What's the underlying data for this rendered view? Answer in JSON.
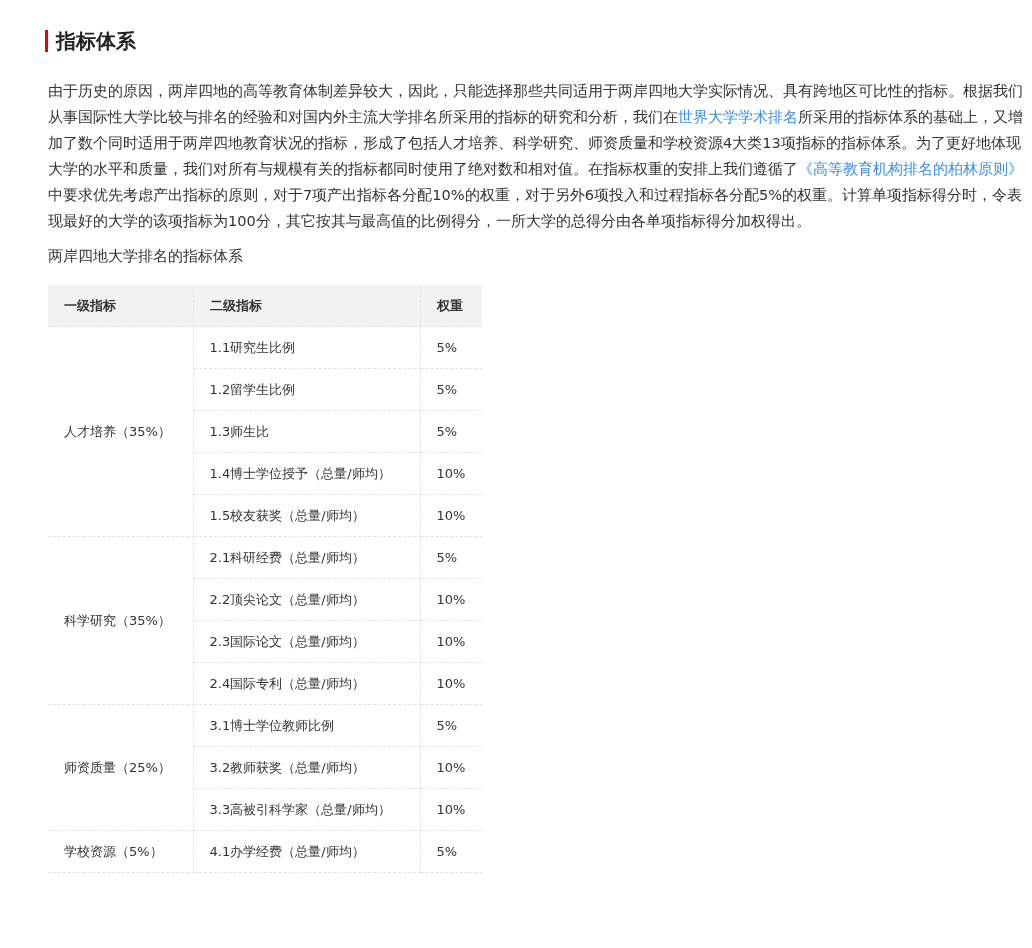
{
  "title": "指标体系",
  "intro": [
    {
      "kind": "text",
      "text": "由于历史的原因，两岸四地的高等教育体制差异较大，因此，只能选择那些共同适用于两岸四地大学实际情况、具有跨地区可比性的指标。根据我们从事国际性大学比较与排名的经验和对国内外主流大学排名所采用的指标的研究和分析，我们在"
    },
    {
      "kind": "link",
      "text": "世界大学学术排名"
    },
    {
      "kind": "text",
      "text": "所采用的指标体系的基础上，又增加了数个同时适用于两岸四地教育状况的指标，形成了包括人才培养、科学研究、师资质量和学校资源4大类13项指标的指标体系。为了更好地体现大学的水平和质量，我们对所有与规模有关的指标都同时使用了绝对数和相对值。在指标权重的安排上我们遵循了"
    },
    {
      "kind": "link",
      "text": "《高等教育机构排名的柏林原则》"
    },
    {
      "kind": "text",
      "text": "中要求优先考虑产出指标的原则，对于7项产出指标各分配10%的权重，对于另外6项投入和过程指标各分配5%的权重。计算单项指标得分时，令表现最好的大学的该项指标为100分，其它按其与最高值的比例得分，一所大学的总得分由各单项指标得分加权得出。"
    }
  ],
  "caption": "两岸四地大学排名的指标体系",
  "table": {
    "columns": [
      "一级指标",
      "二级指标",
      "权重"
    ],
    "groups": [
      {
        "label": "人才培养（35%）",
        "items": [
          {
            "name": "1.1研究生比例",
            "weight": "5%"
          },
          {
            "name": "1.2留学生比例",
            "weight": "5%"
          },
          {
            "name": "1.3师生比",
            "weight": "5%"
          },
          {
            "name": "1.4博士学位授予（总量/师均）",
            "weight": "10%"
          },
          {
            "name": "1.5校友获奖（总量/师均）",
            "weight": "10%"
          }
        ]
      },
      {
        "label": "科学研究（35%）",
        "items": [
          {
            "name": "2.1科研经费（总量/师均）",
            "weight": "5%"
          },
          {
            "name": "2.2顶尖论文（总量/师均）",
            "weight": "10%"
          },
          {
            "name": "2.3国际论文（总量/师均）",
            "weight": "10%"
          },
          {
            "name": "2.4国际专利（总量/师均）",
            "weight": "10%"
          }
        ]
      },
      {
        "label": "师资质量（25%）",
        "items": [
          {
            "name": "3.1博士学位教师比例",
            "weight": "5%"
          },
          {
            "name": "3.2教师获奖（总量/师均）",
            "weight": "10%"
          },
          {
            "name": "3.3高被引科学家（总量/师均）",
            "weight": "10%"
          }
        ]
      },
      {
        "label": "学校资源（5%）",
        "items": [
          {
            "name": "4.1办学经费（总量/师均）",
            "weight": "5%"
          }
        ]
      }
    ]
  }
}
